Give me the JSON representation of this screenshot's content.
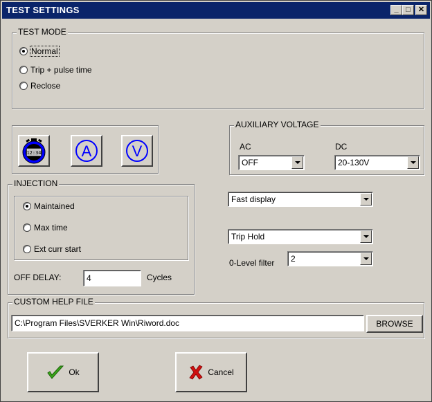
{
  "window": {
    "title": "TEST SETTINGS",
    "minimize_glyph": "_",
    "maximize_glyph": "□",
    "close_glyph": "✕"
  },
  "test_mode": {
    "label": "TEST MODE",
    "options": [
      "Normal",
      "Trip + pulse time",
      "Reclose"
    ],
    "selected": "Normal"
  },
  "toolbar": {
    "icons": [
      "stopwatch-icon",
      "ammeter-icon",
      "voltmeter-icon"
    ],
    "stopwatch_readout": "12:34",
    "ammeter_letter": "A",
    "voltmeter_letter": "V"
  },
  "injection": {
    "label": "INJECTION",
    "options": [
      "Maintained",
      "Max time",
      "Ext curr start"
    ],
    "selected": "Maintained",
    "off_delay_label": "OFF DELAY:",
    "off_delay_value": "4",
    "off_delay_unit": "Cycles"
  },
  "aux_voltage": {
    "label": "AUXILIARY VOLTAGE",
    "ac_label": "AC",
    "ac_value": "OFF",
    "dc_label": "DC",
    "dc_value": "20-130V"
  },
  "display": {
    "display_mode": "Fast display",
    "trip_mode": "Trip Hold",
    "zero_level_label": "0-Level filter",
    "zero_level_value": "2"
  },
  "help_file": {
    "label": "CUSTOM HELP FILE",
    "path": "C:\\Program Files\\SVERKER Win\\Riword.doc",
    "browse_label": "BROWSE"
  },
  "actions": {
    "ok_label": "Ok",
    "cancel_label": "Cancel"
  },
  "colors": {
    "titlebar": "#0a246a",
    "face": "#d4d0c8",
    "icon_blue": "#0000ff",
    "ok_green": "#3aa81a",
    "cancel_red": "#d01010"
  }
}
